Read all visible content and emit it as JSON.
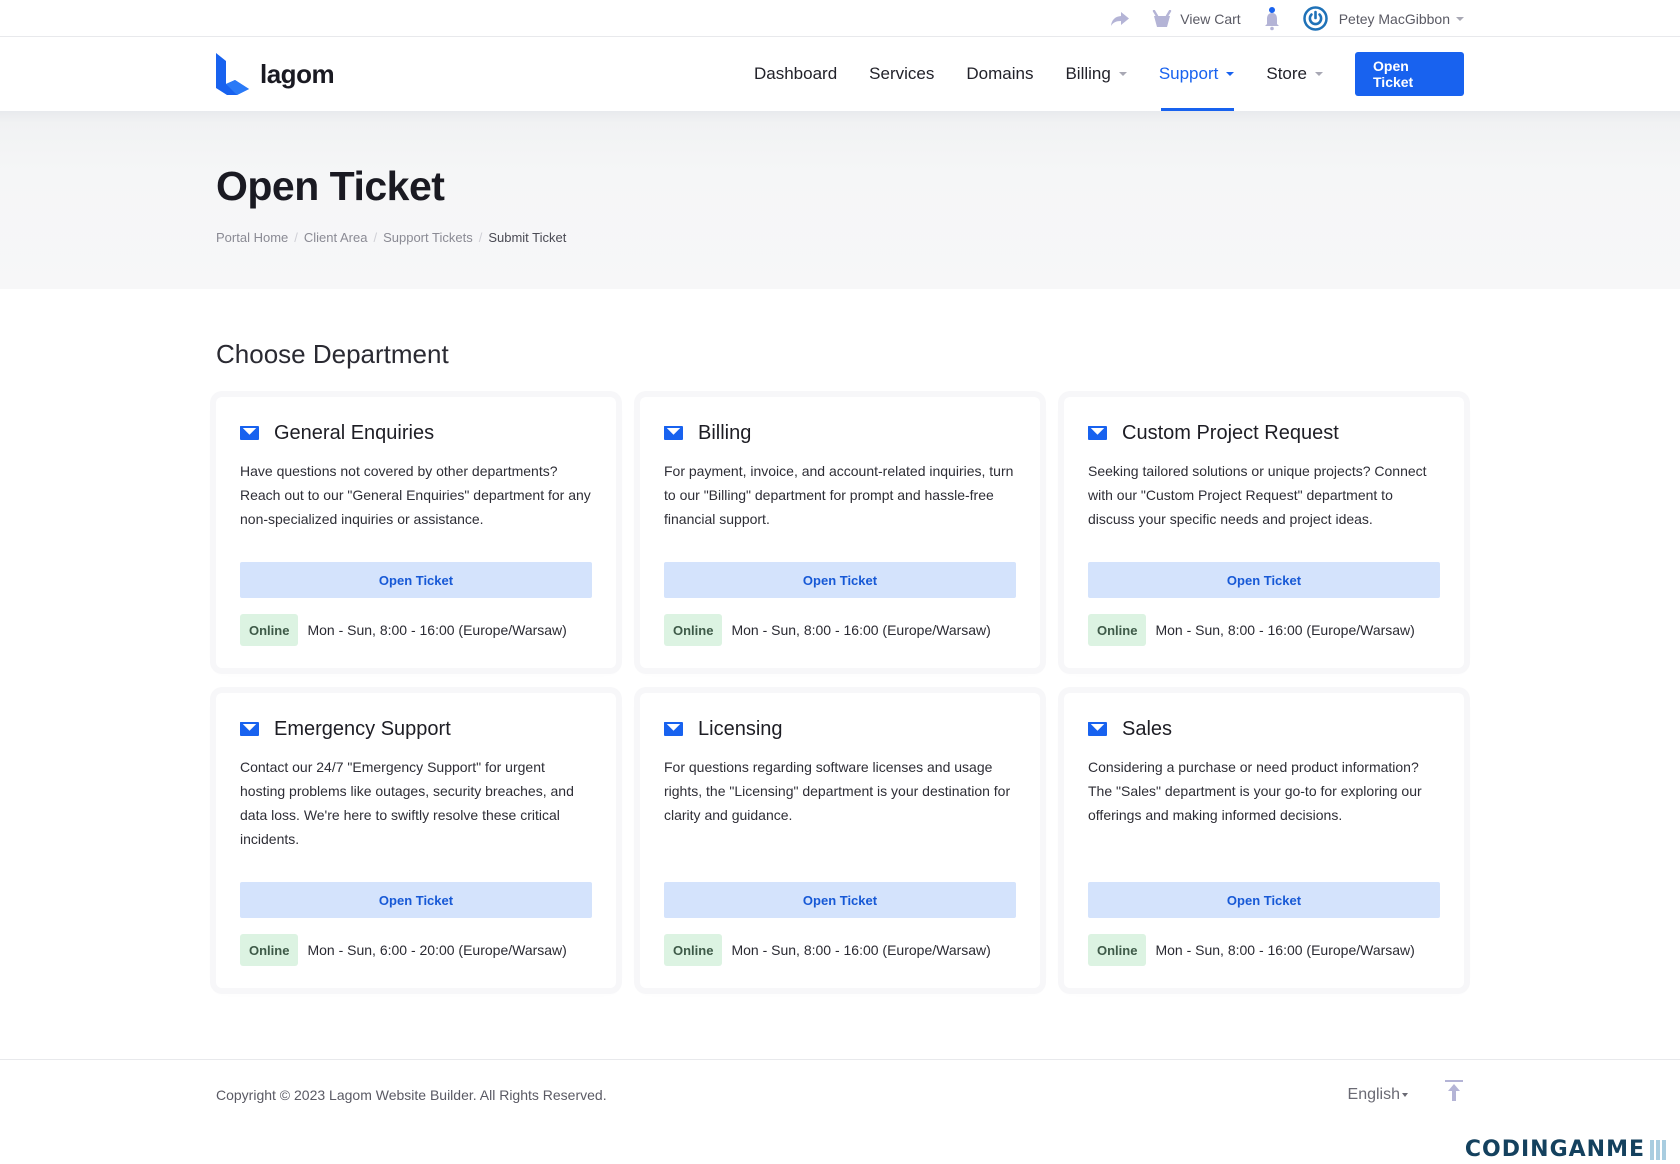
{
  "topbar": {
    "share_icon": "share-arrow-icon",
    "cart_icon": "basket-icon",
    "view_cart": "View Cart",
    "notification_icon": "bell-icon",
    "user_icon": "power-icon",
    "user_name": "Petey MacGibbon"
  },
  "brand": {
    "name": "lagom",
    "color": "#1862ef"
  },
  "nav": {
    "items": [
      {
        "label": "Dashboard",
        "dropdown": false
      },
      {
        "label": "Services",
        "dropdown": false
      },
      {
        "label": "Domains",
        "dropdown": false
      },
      {
        "label": "Billing",
        "dropdown": true
      },
      {
        "label": "Support",
        "dropdown": true,
        "active": true
      },
      {
        "label": "Store",
        "dropdown": true
      }
    ],
    "cta": "Open Ticket"
  },
  "header": {
    "title": "Open Ticket",
    "breadcrumb": [
      "Portal Home",
      "Client Area",
      "Support Tickets",
      "Submit Ticket"
    ]
  },
  "main": {
    "section_title": "Choose Department",
    "departments": [
      {
        "name": "General Enquiries",
        "description": "Have questions not covered by other departments? Reach out to our \"General Enquiries\" department for any non-specialized inquiries or assistance.",
        "button": "Open Ticket",
        "status": "Online",
        "hours": "Mon - Sun, 8:00 - 16:00 (Europe/Warsaw)"
      },
      {
        "name": "Billing",
        "description": "For payment, invoice, and account-related inquiries, turn to our \"Billing\" department for prompt and hassle-free financial support.",
        "button": "Open Ticket",
        "status": "Online",
        "hours": "Mon - Sun, 8:00 - 16:00 (Europe/Warsaw)"
      },
      {
        "name": "Custom Project Request",
        "description": "Seeking tailored solutions or unique projects? Connect with our \"Custom Project Request\" department to discuss your specific needs and project ideas.",
        "button": "Open Ticket",
        "status": "Online",
        "hours": "Mon - Sun, 8:00 - 16:00 (Europe/Warsaw)"
      },
      {
        "name": "Emergency Support",
        "description": "Contact our 24/7 \"Emergency Support\" for urgent hosting problems like outages, security breaches, and data loss. We're here to swiftly resolve these critical incidents.",
        "button": "Open Ticket",
        "status": "Online",
        "hours": "Mon - Sun, 6:00 - 20:00 (Europe/Warsaw)"
      },
      {
        "name": "Licensing",
        "description": "For questions regarding software licenses and usage rights, the \"Licensing\" department is your destination for clarity and guidance.",
        "button": "Open Ticket",
        "status": "Online",
        "hours": "Mon - Sun, 8:00 - 16:00 (Europe/Warsaw)"
      },
      {
        "name": "Sales",
        "description": "Considering a purchase or need product information? The \"Sales\" department is your go-to for exploring our offerings and making informed decisions.",
        "button": "Open Ticket",
        "status": "Online",
        "hours": "Mon - Sun, 8:00 - 16:00 (Europe/Warsaw)"
      }
    ]
  },
  "footer": {
    "copyright": "Copyright © 2023 Lagom Website Builder. All Rights Reserved.",
    "language": "English",
    "to_top_icon": "arrow-up-to-top-icon"
  },
  "watermark": "CODINGANME"
}
